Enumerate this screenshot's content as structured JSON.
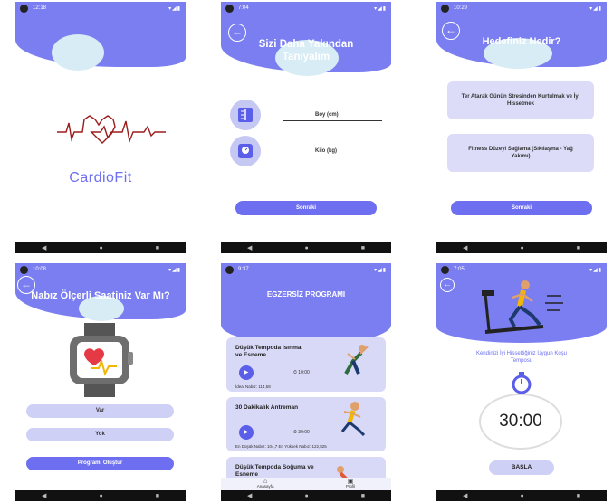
{
  "colors": {
    "primary": "#7b7ef0",
    "button": "#6d6ff0",
    "card": "#dcdcf8",
    "blob": "#d7ecf4"
  },
  "screens": {
    "splash": {
      "status_time": "12:18",
      "app_name": "CardioFit",
      "icon": "heartbeat-line-icon"
    },
    "profile": {
      "status_time": "7:04",
      "title": "Sizi Daha Yakından Tanıyalım",
      "height_label": "Boy (cm)",
      "weight_label": "Kilo (kg)",
      "next_button": "Sonraki"
    },
    "goal": {
      "status_time": "10:29",
      "title": "Hedefiniz Nedir?",
      "option1": "Ter Atarak Günün Stresinden Kurtulmak ve İyi Hissetmek",
      "option2": "Fitness Düzeyi Sağlama (Sıkılaşma - Yağ Yakımı)",
      "next_button": "Sonraki"
    },
    "watch": {
      "status_time": "10:08",
      "title": "Nabız Ölçerli Saatiniz Var Mı?",
      "yes": "Var",
      "no": "Yok",
      "create_button": "Programı Oluştur"
    },
    "program": {
      "status_time": "9:37",
      "title": "EGZERSİZ PROGRAMI",
      "exercises": [
        {
          "title": "Düşük Tempoda Isınma ve Esneme",
          "time": "10:00",
          "info": "İdeal Nabız: 114,58"
        },
        {
          "title": "30 Dakikalık Antreman",
          "time": "30:00",
          "info": "En Düşük Nabız: 104,7  En Yüksek Nabız: 122,825"
        },
        {
          "title": "Düşük Tempoda Soğuma ve Esneme",
          "time": "",
          "info": ""
        }
      ],
      "tab_home": "Anasayfa",
      "tab_profile": "Profil"
    },
    "timer": {
      "status_time": "7:05",
      "caption": "Kendinizi İyi Hissettiğiniz Uygun Koşu Temposu",
      "time": "30:00",
      "start_button": "BAŞLA"
    }
  }
}
